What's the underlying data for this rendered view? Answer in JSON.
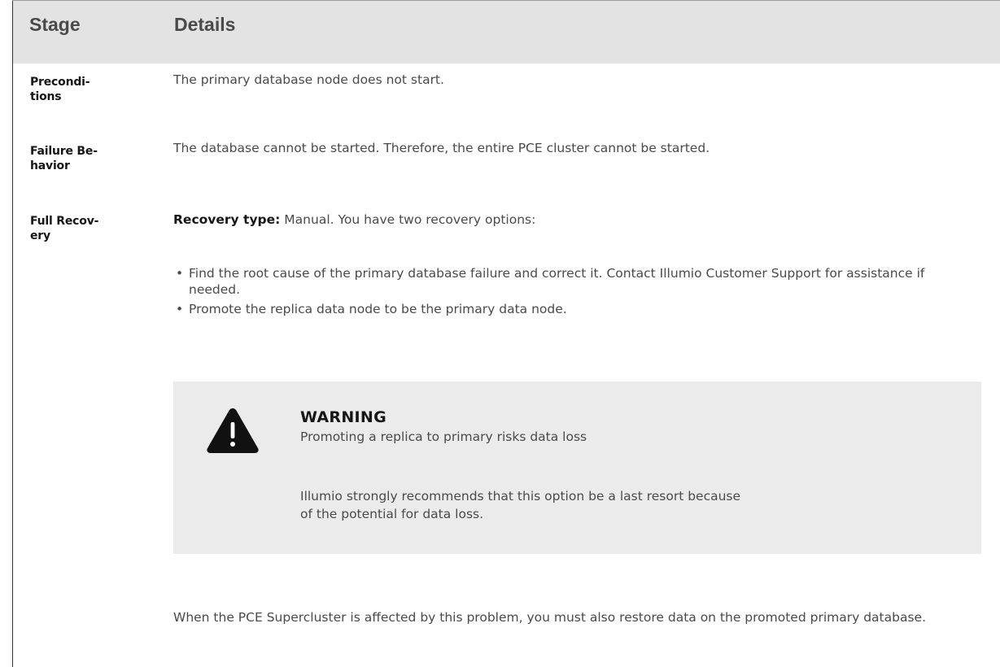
{
  "table": {
    "headers": {
      "stage": "Stage",
      "details": "Details"
    },
    "rows": [
      {
        "stage": [
          "Precondi-",
          "tions"
        ],
        "details": "The primary database node does not start."
      },
      {
        "stage": [
          "Failure Be-",
          "havior"
        ],
        "details": "The database cannot be started. Therefore, the entire PCE cluster cannot be started."
      },
      {
        "stage": [
          "Full Recov-",
          "ery"
        ],
        "recovery_label": "Recovery type:",
        "recovery_text": " Manual. You have two recovery options:",
        "options": [
          "Find the root cause of the primary database failure and correct it. Contact Illumio Customer Support for assistance if needed.",
          "Promote the replica data node to be the primary data node."
        ],
        "warning": {
          "icon": "warning-triangle-icon",
          "title": "WARNING",
          "subtitle": "Promoting a replica to primary risks data loss",
          "body": "Illumio strongly recommends that this option be a last resort because of the potential for data loss."
        },
        "footer_note": "When the PCE Supercluster is affected by this problem, you must also restore data on the promoted primary database."
      }
    ]
  },
  "colors": {
    "header_bg": "#e3e3e3",
    "warning_bg": "#ebebeb",
    "body_text": "#4a4a4a",
    "label_text": "#161616"
  },
  "bullet_glyph": "•"
}
